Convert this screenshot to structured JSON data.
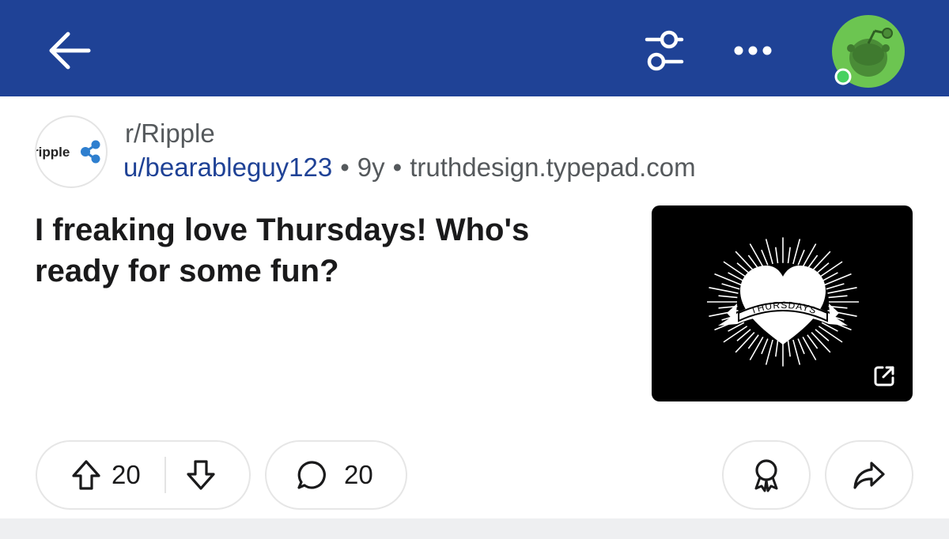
{
  "header": {
    "back_icon": "arrow-left-icon",
    "filter_icon": "sliders-icon",
    "more_icon": "ellipsis-icon",
    "avatar_icon": "snoo-avatar-icon",
    "colors": {
      "bar": "#1f4296",
      "avatar_bg": "#6cc551",
      "online": "#46d160"
    }
  },
  "post": {
    "subreddit": "r/Ripple",
    "subreddit_icon_text": "ripple",
    "author": "u/bearableguy123",
    "separator": "•",
    "age": "9y",
    "domain": "truthdesign.typepad.com",
    "title": "I freaking love Thursdays! Who's ready for some fun?",
    "thumbnail": {
      "banner_text": "THURSDAYS",
      "link_icon": "external-link-icon"
    }
  },
  "actions": {
    "upvote_icon": "upvote-arrow-icon",
    "vote_count": "20",
    "downvote_icon": "downvote-arrow-icon",
    "comment_icon": "comment-bubble-icon",
    "comment_count": "20",
    "award_icon": "award-icon",
    "share_icon": "share-arrow-icon"
  }
}
